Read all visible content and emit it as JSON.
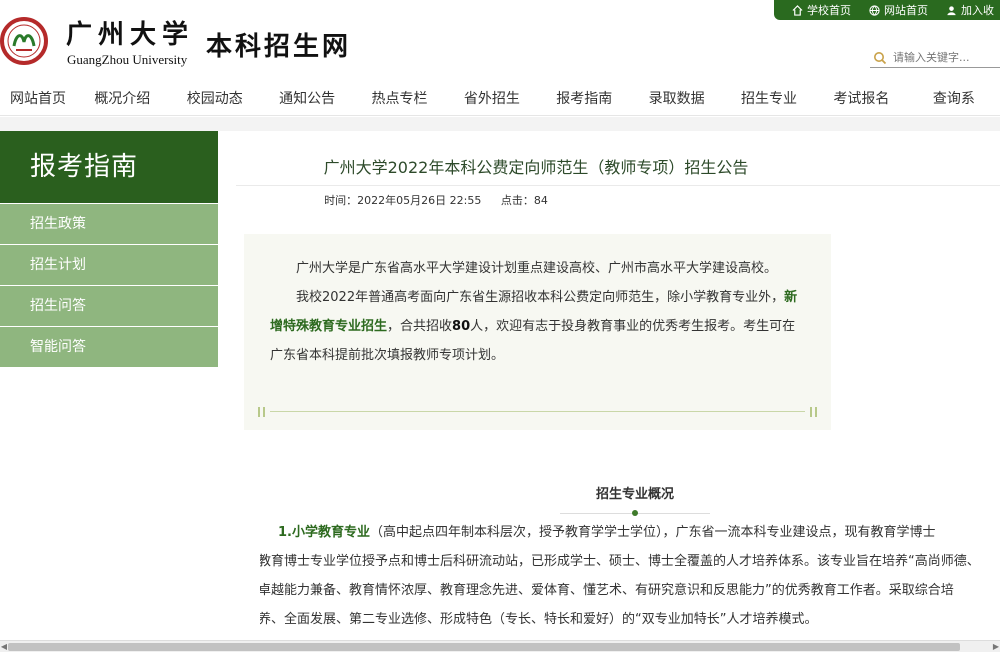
{
  "header": {
    "cn_name": "广州大学",
    "en_name": "GuangZhou University",
    "site_name": "本科招生网",
    "top_links": [
      "学校首页",
      "网站首页",
      "加入收"
    ],
    "search_placeholder": "请输入关键字...",
    "brand_color": "#2a6a1f"
  },
  "nav": [
    "网站首页",
    "概况介绍",
    "校园动态",
    "通知公告",
    "热点专栏",
    "省外招生",
    "报考指南",
    "录取数据",
    "招生专业",
    "考试报名",
    "查询系"
  ],
  "sidebar": {
    "title": "报考指南",
    "items": [
      "招生政策",
      "招生计划",
      "招生问答",
      "智能问答"
    ]
  },
  "article": {
    "title": "广州大学2022年本科公费定向师范生（教师专项）招生公告",
    "time": "时间：2022年05月26日 22:55",
    "views": "点击：84",
    "intro_p1": "广州大学是广东省高水平大学建设计划重点建设高校、广州市高水平大学建设高校。",
    "intro_p2_a": "我校2022年普通高考面向广东省生源招收本科公费定向师范生，除小学教育专业外，",
    "intro_p2_b": "新增特殊教育专业招生",
    "intro_p2_c": "，合共招收",
    "intro_p2_d": "80",
    "intro_p2_e": "人，欢迎有志于投身教育事业的优秀考生报考。考生可在广东省本科提前批次填报教师专项计划。",
    "section_heading": "招生专业概况",
    "body_l1_b": "1.小学教育专业",
    "body_l1": "（高中起点四年制本科层次，授予教育学学士学位），广东省一流本科专业建设点，现有教育学博士",
    "body_l2": "教育博士专业学位授予点和博士后科研流动站，已形成学士、硕士、博士全覆盖的人才培养体系。该专业旨在培养“高尚师德、",
    "body_l3": "卓越能力兼备、教育情怀浓厚、教育理念先进、爱体育、懂艺术、有研究意识和反思能力”的优秀教育工作者。采取综合培",
    "body_l4": "养、全面发展、第二专业选修、形成特色（专长、特长和爱好）的“双专业加特长”人才培养模式。"
  }
}
